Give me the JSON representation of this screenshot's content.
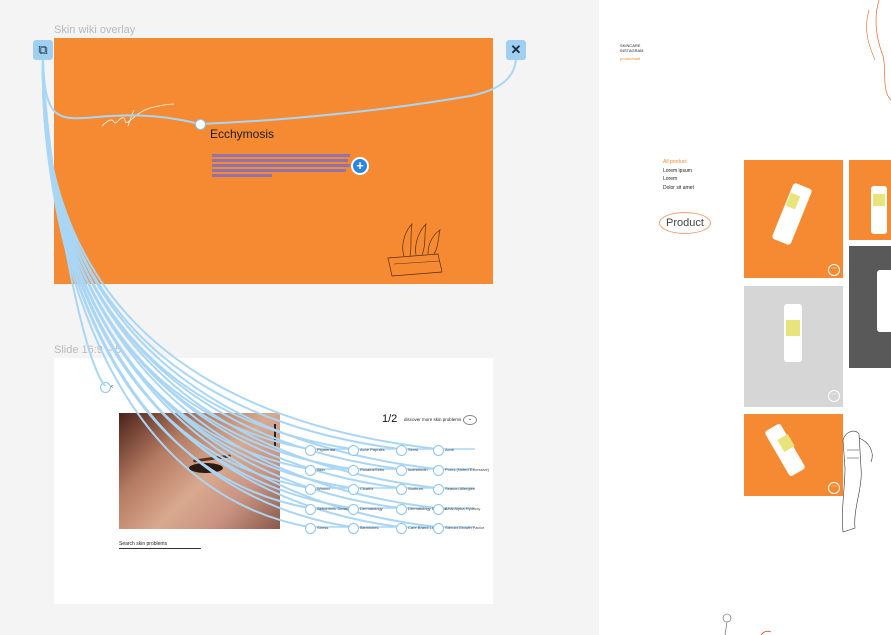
{
  "canvas": {
    "overlay_label": "Skin wiki overlay",
    "slide_label": "Slide 16:9",
    "slide_label_suffix": "– 5"
  },
  "overlay": {
    "title": "Ecchymosis",
    "close_icon": "close-icon",
    "device_icon": "device-icon",
    "add_icon": "plus-circle-icon",
    "accent": "#f58a33"
  },
  "slide": {
    "counter": "1/2",
    "discover_label": "discover more skin problems",
    "search_label": "Search skin problems",
    "rows": [
      [
        "Pigmentat",
        "Acne Papules",
        "Sensi",
        "Acne"
      ],
      [
        "Skin",
        "Rosaea/Sebo",
        "Isotretinoin",
        "Pores (Noted Excessive)"
      ],
      [
        "Wound",
        "Cicatrix",
        "Sunburn",
        "Season Allergies"
      ],
      [
        "Seborrheic Dermatitis",
        "Dermatology",
        "Dermatology Dryness",
        "AHA/Alpha Hydroxy"
      ],
      [
        "Stress",
        "Blemishes",
        "Care Brand Line",
        "Steroid Growth Factor"
      ]
    ]
  },
  "right_panel": {
    "header_lines": [
      "SKINCARE",
      "INSTAGRAM"
    ],
    "header_link": "productwall",
    "menu": [
      "All product",
      "Lorem ipsum",
      "Lorem",
      "Dolor sit amet"
    ],
    "product_button": "Product",
    "colors": {
      "orange": "#f58a33",
      "gray": "#d6d6d6",
      "dark": "#595959"
    }
  }
}
